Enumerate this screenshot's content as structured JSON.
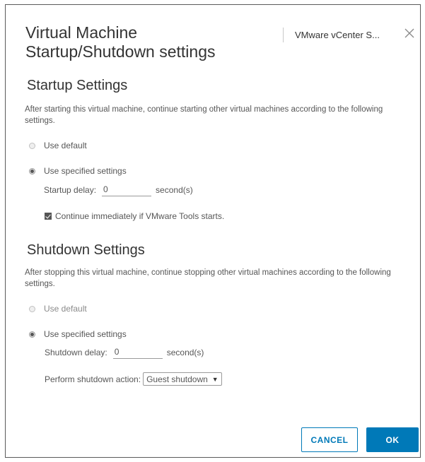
{
  "dialog": {
    "title": "Virtual Machine Startup/Shutdown settings",
    "target": "VMware vCenter S...",
    "close_icon": "close-icon"
  },
  "startup": {
    "heading": "Startup Settings",
    "description": "After starting this virtual machine, continue starting other virtual machines according to the following settings.",
    "use_default_label": "Use default",
    "use_default_selected": false,
    "use_specified_label": "Use specified settings",
    "use_specified_selected": true,
    "delay_label": "Startup delay:",
    "delay_value": "0",
    "delay_unit": "second(s)",
    "continue_label": "Continue immediately if VMware Tools starts.",
    "continue_checked": true
  },
  "shutdown": {
    "heading": "Shutdown Settings",
    "description": "After stopping this virtual machine, continue stopping other virtual machines according to the following settings.",
    "use_default_label": "Use default",
    "use_default_selected": false,
    "use_specified_label": "Use specified settings",
    "use_specified_selected": true,
    "delay_label": "Shutdown delay:",
    "delay_value": "0",
    "delay_unit": "second(s)",
    "action_label": "Perform shutdown action:",
    "action_value": "Guest shutdown"
  },
  "footer": {
    "cancel_label": "CANCEL",
    "ok_label": "OK"
  },
  "colors": {
    "accent": "#0079b8",
    "text": "#565656",
    "heading": "#333333"
  }
}
